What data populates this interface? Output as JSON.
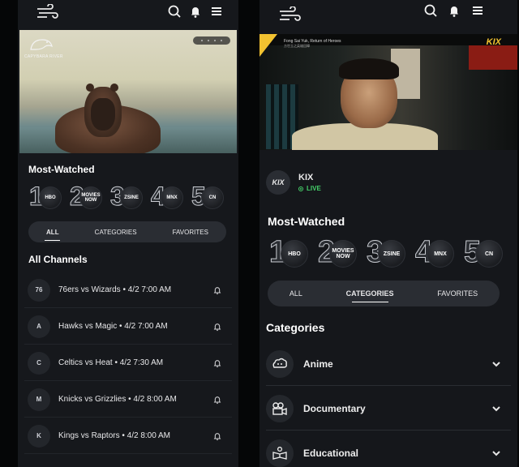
{
  "left": {
    "hero_brand": "CAPYBARA RIVER",
    "section_most_watched": "Most-Watched",
    "most_watched": [
      {
        "rank": "1",
        "channel": "HBO"
      },
      {
        "rank": "2",
        "channel": "MOVIES NOW"
      },
      {
        "rank": "3",
        "channel": "ZSINE"
      },
      {
        "rank": "4",
        "channel": "MNX"
      },
      {
        "rank": "5",
        "channel": "CN"
      }
    ],
    "tabs": [
      "ALL",
      "CATEGORIES",
      "FAVORITES"
    ],
    "active_tab": "ALL",
    "section_all_channels": "All Channels",
    "channels": [
      {
        "logo": "76",
        "title": "76ers vs Wizards • 4/2 7:00 AM"
      },
      {
        "logo": "A",
        "title": "Hawks vs Magic • 4/2 7:00 AM"
      },
      {
        "logo": "C",
        "title": "Celtics vs Heat • 4/2 7:30 AM"
      },
      {
        "logo": "M",
        "title": "Knicks vs Grizzlies • 4/2 8:00 AM"
      },
      {
        "logo": "K",
        "title": "Kings vs Raptors • 4/2 8:00 AM"
      }
    ]
  },
  "right": {
    "video_caption": "Fong Sai Yuk, Return of Heroes",
    "video_caption_sub": "方世玉之英雄回歸",
    "video_channel_mark": "KIX",
    "now_playing": {
      "logo": "KIX",
      "name": "KIX",
      "status": "LIVE"
    },
    "section_most_watched": "Most-Watched",
    "most_watched": [
      {
        "rank": "1",
        "channel": "HBO"
      },
      {
        "rank": "2",
        "channel": "MOVIES NOW"
      },
      {
        "rank": "3",
        "channel": "ZSINE"
      },
      {
        "rank": "4",
        "channel": "MNX"
      },
      {
        "rank": "5",
        "channel": "CN"
      }
    ],
    "tabs": [
      "ALL",
      "CATEGORIES",
      "FAVORITES"
    ],
    "active_tab": "CATEGORIES",
    "section_categories": "Categories",
    "categories": [
      {
        "label": "Anime",
        "icon": "anime-icon"
      },
      {
        "label": "Documentary",
        "icon": "camera-icon"
      },
      {
        "label": "Educational",
        "icon": "book-icon"
      }
    ]
  },
  "colors": {
    "accent_live": "#45d06a",
    "background": "#16181c",
    "tab_bar": "#2a2d33"
  }
}
